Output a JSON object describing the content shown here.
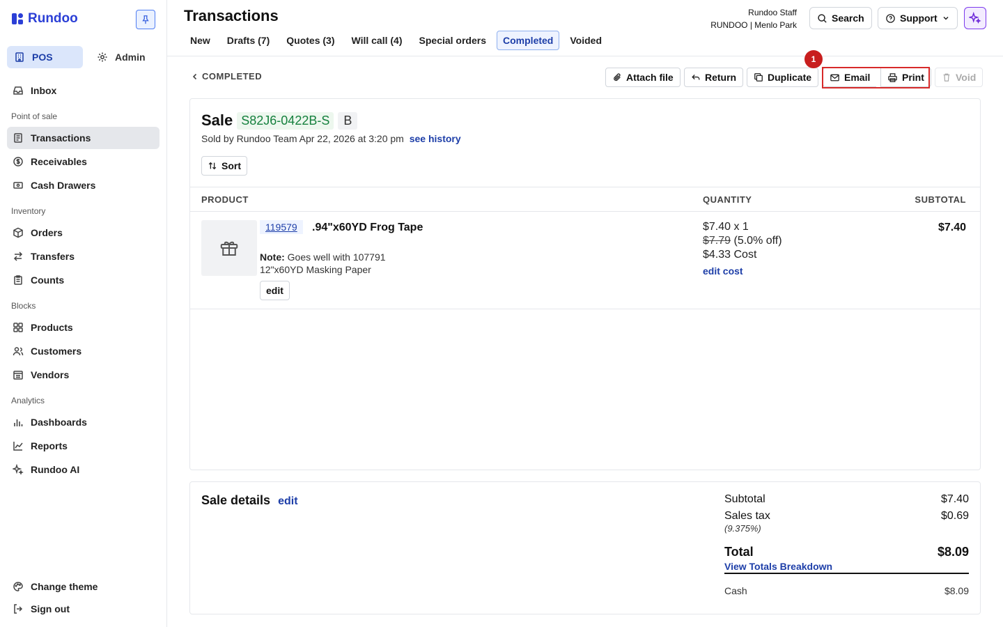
{
  "app": {
    "name": "Rundoo"
  },
  "sidebar": {
    "modes": [
      {
        "label": "POS",
        "icon": "building-icon",
        "active": true
      },
      {
        "label": "Admin",
        "icon": "gear-icon",
        "active": false
      }
    ],
    "inbox": "Inbox",
    "sections": {
      "point_of_sale": "Point of sale",
      "inventory": "Inventory",
      "blocks": "Blocks",
      "analytics": "Analytics"
    },
    "items": {
      "transactions": "Transactions",
      "receivables": "Receivables",
      "cash_drawers": "Cash Drawers",
      "orders": "Orders",
      "transfers": "Transfers",
      "counts": "Counts",
      "products": "Products",
      "customers": "Customers",
      "vendors": "Vendors",
      "dashboards": "Dashboards",
      "reports": "Reports",
      "rundoo_ai": "Rundoo AI"
    },
    "footer": {
      "change_theme": "Change theme",
      "sign_out": "Sign out"
    }
  },
  "header": {
    "title": "Transactions",
    "tabs": [
      {
        "label": "New"
      },
      {
        "label": "Drafts (7)"
      },
      {
        "label": "Quotes (3)"
      },
      {
        "label": "Will call (4)"
      },
      {
        "label": "Special orders"
      },
      {
        "label": "Completed",
        "active": true
      },
      {
        "label": "Voided"
      }
    ],
    "user": {
      "name": "Rundoo Staff",
      "store": "RUNDOO | Menlo Park"
    },
    "search_label": "Search",
    "support_label": "Support"
  },
  "actions": {
    "back_label": "COMPLETED",
    "attach_file": "Attach file",
    "return": "Return",
    "duplicate": "Duplicate",
    "email": "Email",
    "print": "Print",
    "void": "Void",
    "highlight_badge": "1"
  },
  "sale": {
    "label": "Sale",
    "id": "S82J6-0422B-S",
    "tag": "B",
    "sold_by": "Sold by Rundoo Team Apr 22, 2026 at 3:20 pm",
    "history_link": "see history",
    "sort_label": "Sort",
    "columns": {
      "product": "PRODUCT",
      "quantity": "QUANTITY",
      "subtotal": "SUBTOTAL"
    },
    "line_items": [
      {
        "sku": "119579",
        "name": ".94\"x60YD Frog Tape",
        "note_label": "Note:",
        "note_line1": "Goes well with 107791",
        "note_line2": "12\"x60YD Masking Paper",
        "edit_label": "edit",
        "price_qty": "$7.40 x 1",
        "original_price": "$7.79",
        "discount": "(5.0% off)",
        "cost": "$4.33 Cost",
        "edit_cost": "edit cost",
        "subtotal": "$7.40"
      }
    ]
  },
  "sale_details": {
    "title": "Sale details",
    "edit": "edit",
    "subtotal_label": "Subtotal",
    "subtotal": "$7.40",
    "tax_label": "Sales tax",
    "tax": "$0.69",
    "tax_rate": "(9.375%)",
    "total_label": "Total",
    "total": "$8.09",
    "breakdown_link": "View Totals Breakdown",
    "payment_method": "Cash",
    "payment_amount": "$8.09"
  },
  "colors": {
    "accent": "#1d3ea8",
    "sale_id": "#15803d",
    "highlight": "#d72a2a",
    "ai": "#6d28d9"
  }
}
